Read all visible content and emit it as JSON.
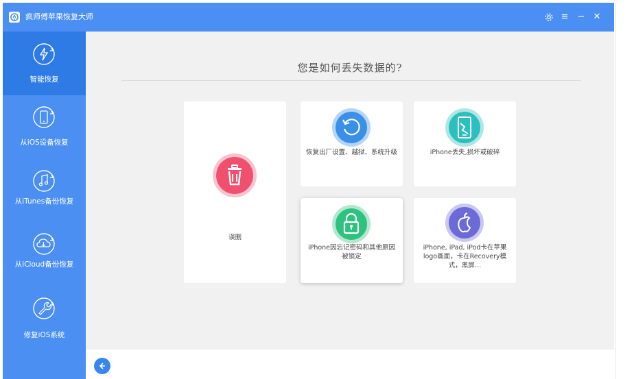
{
  "app": {
    "title": "疯师傅苹果恢复大师"
  },
  "window_controls": {
    "settings_icon": "gear-icon",
    "menu_glyph": "≡",
    "minimize_glyph": "−",
    "close_glyph": "✕"
  },
  "sidebar": {
    "items": [
      {
        "label": "智能恢复",
        "icon": "smart-recovery-icon",
        "active": true
      },
      {
        "label": "从iOS设备恢复",
        "icon": "phone-icon",
        "active": false
      },
      {
        "label": "从iTunes备份恢复",
        "icon": "music-note-icon",
        "active": false
      },
      {
        "label": "从iCloud备份恢复",
        "icon": "cloud-download-icon",
        "active": false
      },
      {
        "label": "修复iOS系统",
        "icon": "wrench-icon",
        "active": false
      }
    ]
  },
  "main": {
    "question": "您是如何丢失数据的?",
    "cards": [
      {
        "label": "误删",
        "icon": "trash-icon",
        "color": "#f0506e",
        "ring": "#f9c3cf"
      },
      {
        "label": "恢复出厂设置、越狱、系统升级",
        "icon": "restore-icon",
        "color": "#3a8fe8",
        "ring": "#b5d5f5"
      },
      {
        "label": "iPhone丢失,损坏或破碎",
        "icon": "broken-phone-icon",
        "color": "#2bbfbf",
        "ring": "#aee6e6"
      },
      {
        "label": "iPhone因忘记密码和其他原因被锁定",
        "icon": "lock-icon",
        "color": "#2ec27e",
        "ring": "#b3e8cf"
      },
      {
        "label": "iPhone, iPad, iPod卡在苹果logo画面，卡在Recovery模式，黑屏…",
        "icon": "apple-icon",
        "color": "#6a6ad8",
        "ring": "#c8c8f0"
      }
    ]
  },
  "footer": {
    "back_icon": "arrow-left-icon"
  },
  "colors": {
    "primary": "#4a8ff1",
    "sidebar_active": "#2f7be6",
    "background": "#f1f1f1"
  }
}
